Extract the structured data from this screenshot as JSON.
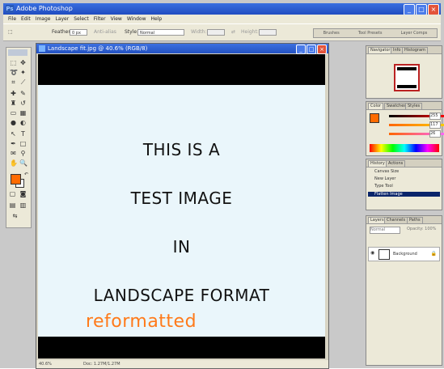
{
  "window": {
    "title": "Adobe Photoshop",
    "logo": "Ps"
  },
  "menu": [
    "File",
    "Edit",
    "Image",
    "Layer",
    "Select",
    "Filter",
    "View",
    "Window",
    "Help"
  ],
  "options": {
    "feather_label": "Feather:",
    "feather_value": "0 px",
    "antialias_label": "Anti-alias",
    "style_label": "Style:",
    "style_value": "Normal",
    "width_label": "Width:",
    "height_label": "Height:",
    "tray": [
      "Brushes",
      "Tool Presets",
      "Layer Comps"
    ]
  },
  "document": {
    "title": "Landscape fit.jpg @ 40.6% (RGB/8)",
    "lines": [
      "THIS IS A",
      "TEST IMAGE",
      "IN",
      "LANDSCAPE FORMAT"
    ],
    "accent_line": "reformatted",
    "status_zoom": "40.6%",
    "status_doc": "Doc: 1.27M/1.27M"
  },
  "swatches": {
    "foreground": "#ff6b00",
    "background": "#ffffff"
  },
  "navigator": {
    "tabs": [
      "Navigator",
      "Info",
      "Histogram"
    ]
  },
  "color": {
    "tabs": [
      "Color",
      "Swatches",
      "Styles"
    ],
    "r": "255",
    "g": "117",
    "b": "26"
  },
  "history": {
    "tabs": [
      "History",
      "Actions"
    ],
    "items": [
      "Canvas Size",
      "New Layer",
      "Type Tool",
      "Flatten Image"
    ]
  },
  "layers": {
    "tabs": [
      "Layers",
      "Channels",
      "Paths"
    ],
    "blend": "Normal",
    "opacity": "Opacity: 100%",
    "layer_name": "Background"
  }
}
